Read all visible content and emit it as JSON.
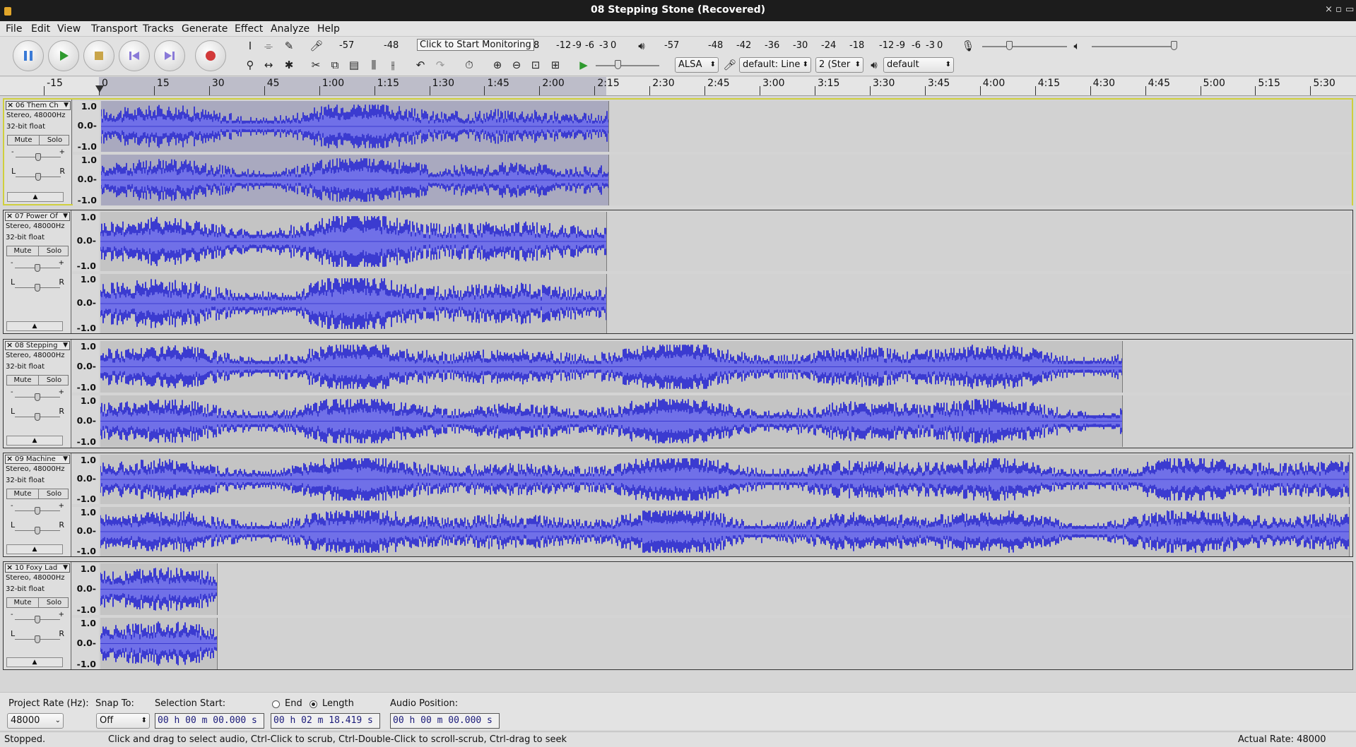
{
  "window": {
    "title": "08 Stepping Stone (Recovered)",
    "controls": [
      "×",
      "▫",
      "▭"
    ]
  },
  "menu": [
    "File",
    "Edit",
    "View",
    "Transport",
    "Tracks",
    "Generate",
    "Effect",
    "Analyze",
    "Help"
  ],
  "transport": {
    "buttons": [
      "pause-icon",
      "play-icon",
      "stop-icon",
      "skip-start-icon",
      "skip-end-icon",
      "record-icon"
    ]
  },
  "meters": {
    "record_scale": [
      "-57",
      "-48",
      "-12",
      "-9",
      "-6",
      "-3",
      "0"
    ],
    "record_tooltip": "Click to Start Monitoring",
    "record_after": "8",
    "playback_scale": [
      "-57",
      "-48",
      "-42",
      "-36",
      "-30",
      "-24",
      "-18",
      "-12",
      "-9",
      "-6",
      "-3",
      "0"
    ],
    "lr_label": "L R"
  },
  "mixer": {
    "record_volume": 0.3,
    "playback_volume": 1.0
  },
  "device": {
    "host": "ALSA",
    "input": "default: Line",
    "channels": "2 (Ster",
    "output": "default"
  },
  "ruler": {
    "ticks": [
      "-15",
      "0",
      "15",
      "30",
      "45",
      "1:00",
      "1:15",
      "1:30",
      "1:45",
      "2:00",
      "2:15",
      "2:30",
      "2:45",
      "3:00",
      "3:15",
      "3:30",
      "3:45",
      "4:00",
      "4:15",
      "4:30",
      "4:45",
      "5:00",
      "5:15",
      "5:30"
    ]
  },
  "tracks": [
    {
      "name": "06 Them Ch",
      "info1": "Stereo, 48000Hz",
      "info2": "32-bit float",
      "mute": "Mute",
      "solo": "Solo",
      "selected": true,
      "duration_s": 138.4
    },
    {
      "name": "07 Power Of",
      "info1": "Stereo, 48000Hz",
      "info2": "32-bit float",
      "mute": "Mute",
      "solo": "Solo",
      "selected": false,
      "duration_s": 138.0
    },
    {
      "name": "08 Stepping",
      "info1": "Stereo, 48000Hz",
      "info2": "32-bit float",
      "mute": "Mute",
      "solo": "Solo",
      "selected": false,
      "duration_s": 278.5
    },
    {
      "name": "09 Machine",
      "info1": "Stereo, 48000Hz",
      "info2": "32-bit float",
      "mute": "Mute",
      "solo": "Solo",
      "selected": false,
      "duration_s": 342.0
    },
    {
      "name": "10 Foxy Lad",
      "info1": "Stereo, 48000Hz",
      "info2": "32-bit float",
      "mute": "Mute",
      "solo": "Solo",
      "selected": false,
      "duration_s": 32.0
    }
  ],
  "scale_labels": [
    "1.0",
    "0.0-",
    "-1.0"
  ],
  "selection": {
    "project_rate_label": "Project Rate (Hz):",
    "project_rate": "48000",
    "snap_label": "Snap To:",
    "snap_value": "Off",
    "start_label": "Selection Start:",
    "end_label": "End",
    "length_label": "Length",
    "start_value": "00 h 00 m 00.000 s",
    "length_value": "00 h 02 m 18.419 s",
    "audio_pos_label": "Audio Position:",
    "audio_pos_value": "00 h 00 m 00.000 s"
  },
  "status": {
    "state": "Stopped.",
    "hint": "Click and drag to select audio, Ctrl-Click to scrub, Ctrl-Double-Click to scroll-scrub, Ctrl-drag to seek",
    "rate": "Actual Rate: 48000"
  },
  "colors": {
    "wave": "#3b3bd0",
    "wave_rms": "#7070e8",
    "selected_border": "#cfcf3d"
  }
}
